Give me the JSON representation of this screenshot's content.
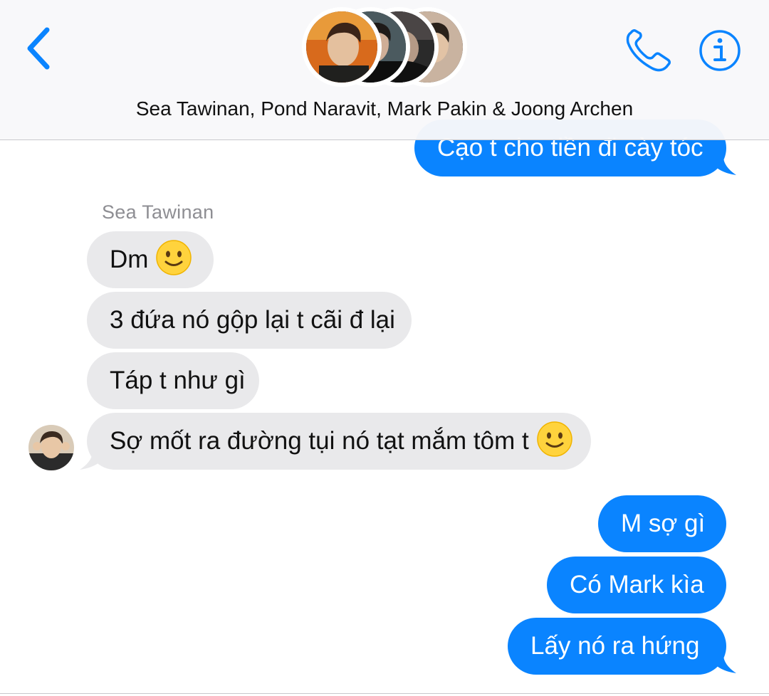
{
  "header": {
    "members_label": "Sea Tawinan, Pond Naravit, Mark Pakin & Joong Archen",
    "avatar_count": 4
  },
  "colors": {
    "outgoing_bubble": "#0a84ff",
    "incoming_bubble": "#e9e9eb",
    "accent": "#0a84ff"
  },
  "icons": {
    "back": "chevron-left-icon",
    "phone": "phone-icon",
    "info": "info-icon",
    "emoji": "slightly-smiling-face"
  },
  "messages": [
    {
      "direction": "outgoing",
      "text": "Cạo t cho tiền đi cày tóc"
    },
    {
      "direction": "incoming",
      "sender": "Sea Tawinan",
      "text": "Dm",
      "emoji": "🙂"
    },
    {
      "direction": "incoming",
      "text": "3 đứa nó gộp lại t cãi đ lại"
    },
    {
      "direction": "incoming",
      "text": "Táp t như gì"
    },
    {
      "direction": "incoming",
      "text": "Sợ mốt ra đường tụi nó tạt mắm tôm t",
      "emoji": "🙂"
    },
    {
      "direction": "outgoing",
      "text": "M sợ gì"
    },
    {
      "direction": "outgoing",
      "text": "Có Mark kìa"
    },
    {
      "direction": "outgoing",
      "text": "Lấy nó ra hứng"
    }
  ]
}
